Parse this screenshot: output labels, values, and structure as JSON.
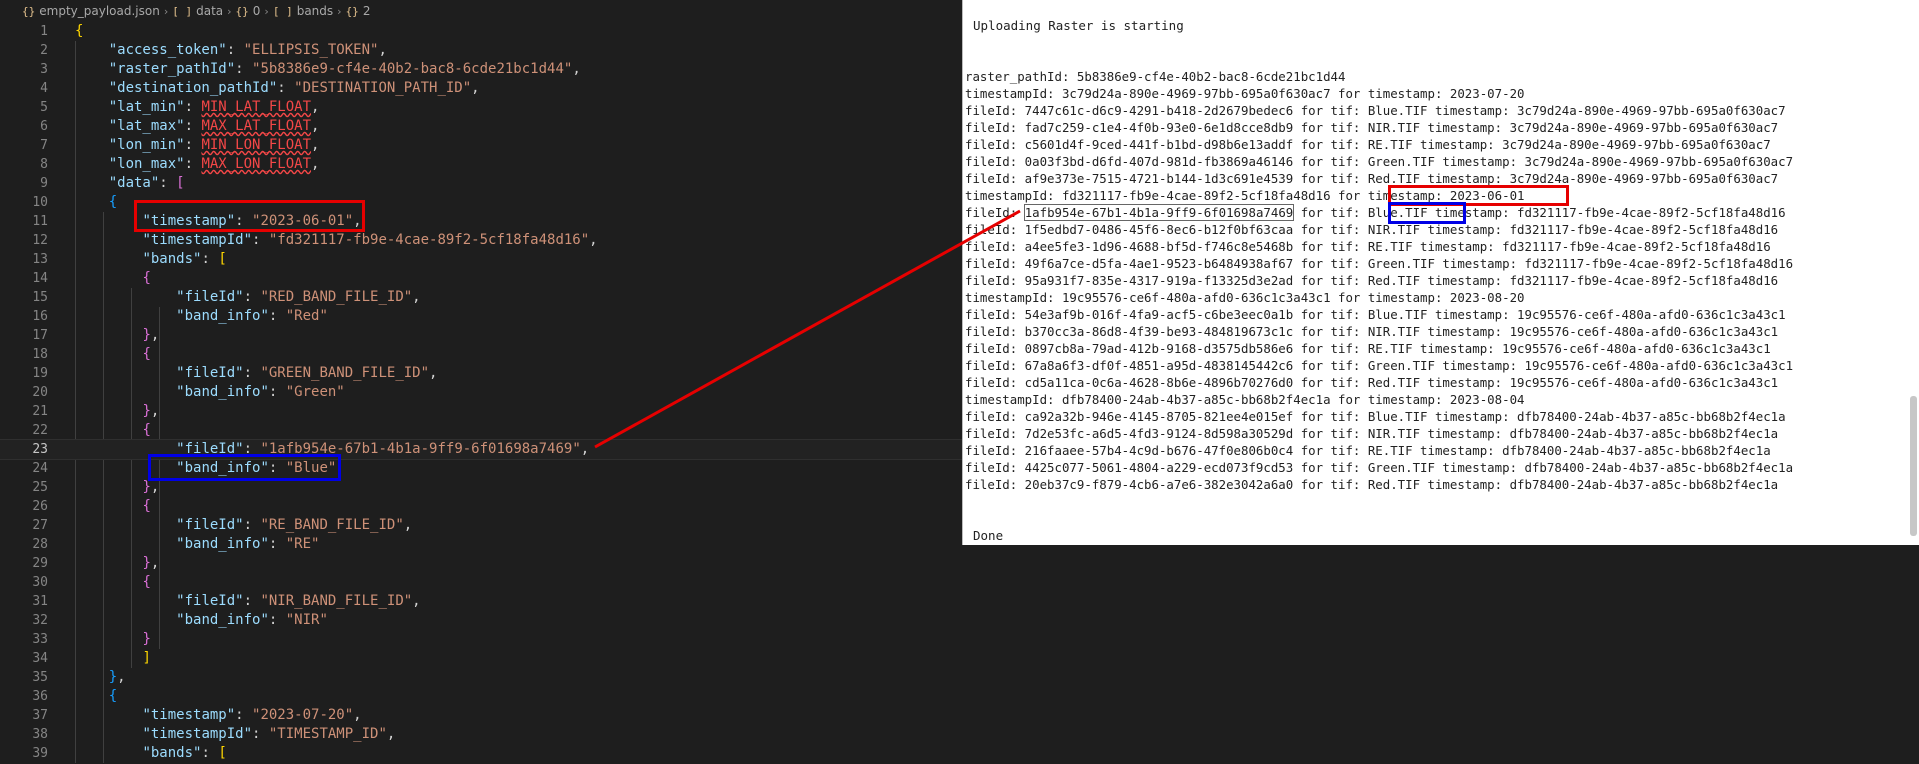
{
  "breadcrumb": {
    "file_icon": "{}",
    "file": "empty_payload.json",
    "items": [
      {
        "icon": "[ ]",
        "label": "data"
      },
      {
        "icon": "{}",
        "label": "0"
      },
      {
        "icon": "[ ]",
        "label": "bands"
      },
      {
        "icon": "{}",
        "label": "2"
      }
    ]
  },
  "editor": {
    "current_line": 23,
    "lines": [
      {
        "n": "1",
        "tokens": [
          {
            "t": "{",
            "c": "b1"
          }
        ]
      },
      {
        "n": "2",
        "tokens": [
          {
            "t": "    "
          },
          {
            "t": "\"access_token\"",
            "c": "k"
          },
          {
            "t": ": "
          },
          {
            "t": "\"ELLIPSIS_TOKEN\"",
            "c": "s"
          },
          {
            "t": ","
          }
        ]
      },
      {
        "n": "3",
        "tokens": [
          {
            "t": "    "
          },
          {
            "t": "\"raster_pathId\"",
            "c": "k"
          },
          {
            "t": ": "
          },
          {
            "t": "\"5b8386e9-cf4e-40b2-bac8-6cde21bc1d44\"",
            "c": "s"
          },
          {
            "t": ","
          }
        ]
      },
      {
        "n": "4",
        "tokens": [
          {
            "t": "    "
          },
          {
            "t": "\"destination_pathId\"",
            "c": "k"
          },
          {
            "t": ": "
          },
          {
            "t": "\"DESTINATION_PATH_ID\"",
            "c": "s"
          },
          {
            "t": ","
          }
        ]
      },
      {
        "n": "5",
        "tokens": [
          {
            "t": "    "
          },
          {
            "t": "\"lat_min\"",
            "c": "k"
          },
          {
            "t": ": "
          },
          {
            "t": "MIN_LAT_FLOAT",
            "c": "err"
          },
          {
            "t": ","
          }
        ]
      },
      {
        "n": "6",
        "tokens": [
          {
            "t": "    "
          },
          {
            "t": "\"lat_max\"",
            "c": "k"
          },
          {
            "t": ": "
          },
          {
            "t": "MAX_LAT_FLOAT",
            "c": "err"
          },
          {
            "t": ","
          }
        ]
      },
      {
        "n": "7",
        "tokens": [
          {
            "t": "    "
          },
          {
            "t": "\"lon_min\"",
            "c": "k"
          },
          {
            "t": ": "
          },
          {
            "t": "MIN_LON_FLOAT",
            "c": "err"
          },
          {
            "t": ","
          }
        ]
      },
      {
        "n": "8",
        "tokens": [
          {
            "t": "    "
          },
          {
            "t": "\"lon_max\"",
            "c": "k"
          },
          {
            "t": ": "
          },
          {
            "t": "MAX_LON_FLOAT",
            "c": "err"
          },
          {
            "t": ","
          }
        ]
      },
      {
        "n": "9",
        "tokens": [
          {
            "t": "    "
          },
          {
            "t": "\"data\"",
            "c": "k"
          },
          {
            "t": ": "
          },
          {
            "t": "[",
            "c": "b2"
          }
        ]
      },
      {
        "n": "10",
        "tokens": [
          {
            "t": "    "
          },
          {
            "t": "{",
            "c": "b3"
          }
        ]
      },
      {
        "n": "11",
        "tokens": [
          {
            "t": "        "
          },
          {
            "t": "\"timestamp\"",
            "c": "k"
          },
          {
            "t": ": "
          },
          {
            "t": "\"2023-06-01\"",
            "c": "s"
          },
          {
            "t": ","
          }
        ]
      },
      {
        "n": "12",
        "tokens": [
          {
            "t": "        "
          },
          {
            "t": "\"timestampId\"",
            "c": "k"
          },
          {
            "t": ": "
          },
          {
            "t": "\"fd321117-fb9e-4cae-89f2-5cf18fa48d16\"",
            "c": "s"
          },
          {
            "t": ","
          }
        ]
      },
      {
        "n": "13",
        "tokens": [
          {
            "t": "        "
          },
          {
            "t": "\"bands\"",
            "c": "k"
          },
          {
            "t": ": "
          },
          {
            "t": "[",
            "c": "b1"
          }
        ]
      },
      {
        "n": "14",
        "tokens": [
          {
            "t": "        "
          },
          {
            "t": "{",
            "c": "b2"
          }
        ]
      },
      {
        "n": "15",
        "tokens": [
          {
            "t": "            "
          },
          {
            "t": "\"fileId\"",
            "c": "k"
          },
          {
            "t": ": "
          },
          {
            "t": "\"RED_BAND_FILE_ID\"",
            "c": "s"
          },
          {
            "t": ","
          }
        ]
      },
      {
        "n": "16",
        "tokens": [
          {
            "t": "            "
          },
          {
            "t": "\"band_info\"",
            "c": "k"
          },
          {
            "t": ": "
          },
          {
            "t": "\"Red\"",
            "c": "s"
          }
        ]
      },
      {
        "n": "17",
        "tokens": [
          {
            "t": "        "
          },
          {
            "t": "}",
            "c": "b2"
          },
          {
            "t": ","
          }
        ]
      },
      {
        "n": "18",
        "tokens": [
          {
            "t": "        "
          },
          {
            "t": "{",
            "c": "b2"
          }
        ]
      },
      {
        "n": "19",
        "tokens": [
          {
            "t": "            "
          },
          {
            "t": "\"fileId\"",
            "c": "k"
          },
          {
            "t": ": "
          },
          {
            "t": "\"GREEN_BAND_FILE_ID\"",
            "c": "s"
          },
          {
            "t": ","
          }
        ]
      },
      {
        "n": "20",
        "tokens": [
          {
            "t": "            "
          },
          {
            "t": "\"band_info\"",
            "c": "k"
          },
          {
            "t": ": "
          },
          {
            "t": "\"Green\"",
            "c": "s"
          }
        ]
      },
      {
        "n": "21",
        "tokens": [
          {
            "t": "        "
          },
          {
            "t": "}",
            "c": "b2"
          },
          {
            "t": ","
          }
        ]
      },
      {
        "n": "22",
        "tokens": [
          {
            "t": "        "
          },
          {
            "t": "{",
            "c": "b2"
          }
        ]
      },
      {
        "n": "23",
        "tokens": [
          {
            "t": "            "
          },
          {
            "t": "\"fileId\"",
            "c": "k"
          },
          {
            "t": ": "
          },
          {
            "t": "\"1afb954e-67b1-4b1a-9ff9-6f01698a7469\"",
            "c": "s"
          },
          {
            "t": ","
          }
        ]
      },
      {
        "n": "24",
        "tokens": [
          {
            "t": "            "
          },
          {
            "t": "\"band_info\"",
            "c": "k"
          },
          {
            "t": ": "
          },
          {
            "t": "\"Blue\"",
            "c": "s"
          }
        ]
      },
      {
        "n": "25",
        "tokens": [
          {
            "t": "        "
          },
          {
            "t": "}",
            "c": "b2"
          },
          {
            "t": ","
          }
        ]
      },
      {
        "n": "26",
        "tokens": [
          {
            "t": "        "
          },
          {
            "t": "{",
            "c": "b2"
          }
        ]
      },
      {
        "n": "27",
        "tokens": [
          {
            "t": "            "
          },
          {
            "t": "\"fileId\"",
            "c": "k"
          },
          {
            "t": ": "
          },
          {
            "t": "\"RE_BAND_FILE_ID\"",
            "c": "s"
          },
          {
            "t": ","
          }
        ]
      },
      {
        "n": "28",
        "tokens": [
          {
            "t": "            "
          },
          {
            "t": "\"band_info\"",
            "c": "k"
          },
          {
            "t": ": "
          },
          {
            "t": "\"RE\"",
            "c": "s"
          }
        ]
      },
      {
        "n": "29",
        "tokens": [
          {
            "t": "        "
          },
          {
            "t": "}",
            "c": "b2"
          },
          {
            "t": ","
          }
        ]
      },
      {
        "n": "30",
        "tokens": [
          {
            "t": "        "
          },
          {
            "t": "{",
            "c": "b2"
          }
        ]
      },
      {
        "n": "31",
        "tokens": [
          {
            "t": "            "
          },
          {
            "t": "\"fileId\"",
            "c": "k"
          },
          {
            "t": ": "
          },
          {
            "t": "\"NIR_BAND_FILE_ID\"",
            "c": "s"
          },
          {
            "t": ","
          }
        ]
      },
      {
        "n": "32",
        "tokens": [
          {
            "t": "            "
          },
          {
            "t": "\"band_info\"",
            "c": "k"
          },
          {
            "t": ": "
          },
          {
            "t": "\"NIR\"",
            "c": "s"
          }
        ]
      },
      {
        "n": "33",
        "tokens": [
          {
            "t": "        "
          },
          {
            "t": "}",
            "c": "b2"
          }
        ]
      },
      {
        "n": "34",
        "tokens": [
          {
            "t": "        "
          },
          {
            "t": "]",
            "c": "b1"
          }
        ]
      },
      {
        "n": "35",
        "tokens": [
          {
            "t": "    "
          },
          {
            "t": "}",
            "c": "b3"
          },
          {
            "t": ","
          }
        ]
      },
      {
        "n": "36",
        "tokens": [
          {
            "t": "    "
          },
          {
            "t": "{",
            "c": "b3"
          }
        ]
      },
      {
        "n": "37",
        "tokens": [
          {
            "t": "        "
          },
          {
            "t": "\"timestamp\"",
            "c": "k"
          },
          {
            "t": ": "
          },
          {
            "t": "\"2023-07-20\"",
            "c": "s"
          },
          {
            "t": ","
          }
        ]
      },
      {
        "n": "38",
        "tokens": [
          {
            "t": "        "
          },
          {
            "t": "\"timestampId\"",
            "c": "k"
          },
          {
            "t": ": "
          },
          {
            "t": "\"TIMESTAMP_ID\"",
            "c": "s"
          },
          {
            "t": ","
          }
        ]
      },
      {
        "n": "39",
        "tokens": [
          {
            "t": "        "
          },
          {
            "t": "\"bands\"",
            "c": "k"
          },
          {
            "t": ": "
          },
          {
            "t": "[",
            "c": "b1"
          }
        ]
      }
    ]
  },
  "terminal": {
    "header": "Uploading Raster is starting",
    "footer": "Done",
    "log": [
      "raster_pathId: 5b8386e9-cf4e-40b2-bac8-6cde21bc1d44",
      "timestampId: 3c79d24a-890e-4969-97bb-695a0f630ac7 for timestamp: 2023-07-20",
      "fileId: 7447c61c-d6c9-4291-b418-2d2679bedec6 for tif: Blue.TIF timestamp: 3c79d24a-890e-4969-97bb-695a0f630ac7",
      "fileId: fad7c259-c1e4-4f0b-93e0-6e1d8cce8db9 for tif: NIR.TIF timestamp: 3c79d24a-890e-4969-97bb-695a0f630ac7",
      "fileId: c5601d4f-9ced-441f-b1bd-d98b6e13addf for tif: RE.TIF timestamp: 3c79d24a-890e-4969-97bb-695a0f630ac7",
      "fileId: 0a03f3bd-d6fd-407d-981d-fb3869a46146 for tif: Green.TIF timestamp: 3c79d24a-890e-4969-97bb-695a0f630ac7",
      "fileId: af9e373e-7515-4721-b144-1d3c691e4539 for tif: Red.TIF timestamp: 3c79d24a-890e-4969-97bb-695a0f630ac7",
      "timestampId: fd321117-fb9e-4cae-89f2-5cf18fa48d16 for timestamp: 2023-06-01",
      "fileId: 1afb954e-67b1-4b1a-9ff9-6f01698a7469 for tif: Blue.TIF timestamp: fd321117-fb9e-4cae-89f2-5cf18fa48d16",
      "fileId: 1f5edbd7-0486-45f6-8ec6-b12f0bf63caa for tif: NIR.TIF timestamp: fd321117-fb9e-4cae-89f2-5cf18fa48d16",
      "fileId: a4ee5fe3-1d96-4688-bf5d-f746c8e5468b for tif: RE.TIF timestamp: fd321117-fb9e-4cae-89f2-5cf18fa48d16",
      "fileId: 49f6a7ce-d5fa-4ae1-9523-b6484938af67 for tif: Green.TIF timestamp: fd321117-fb9e-4cae-89f2-5cf18fa48d16",
      "fileId: 95a931f7-835e-4317-919a-f13325d3e2ad for tif: Red.TIF timestamp: fd321117-fb9e-4cae-89f2-5cf18fa48d16",
      "timestampId: 19c95576-ce6f-480a-afd0-636c1c3a43c1 for timestamp: 2023-08-20",
      "fileId: 54e3af9b-016f-4fa9-acf5-c6be3eec0a1b for tif: Blue.TIF timestamp: 19c95576-ce6f-480a-afd0-636c1c3a43c1",
      "fileId: b370cc3a-86d8-4f39-be93-484819673c1c for tif: NIR.TIF timestamp: 19c95576-ce6f-480a-afd0-636c1c3a43c1",
      "fileId: 0897cb8a-79ad-412b-9168-d3575db586e6 for tif: RE.TIF timestamp: 19c95576-ce6f-480a-afd0-636c1c3a43c1",
      "fileId: 67a8a6f3-df0f-4851-a95d-4838145442c6 for tif: Green.TIF timestamp: 19c95576-ce6f-480a-afd0-636c1c3a43c1",
      "fileId: cd5a11ca-0c6a-4628-8b6e-4896b70276d0 for tif: Red.TIF timestamp: 19c95576-ce6f-480a-afd0-636c1c3a43c1",
      "timestampId: dfb78400-24ab-4b37-a85c-bb68b2f4ec1a for timestamp: 2023-08-04",
      "fileId: ca92a32b-946e-4145-8705-821ee4e015ef for tif: Blue.TIF timestamp: dfb78400-24ab-4b37-a85c-bb68b2f4ec1a",
      "fileId: 7d2e53fc-a6d5-4fd3-9124-8d598a30529d for tif: NIR.TIF timestamp: dfb78400-24ab-4b37-a85c-bb68b2f4ec1a",
      "fileId: 216faaee-57b4-4c9d-b676-47f0e806b0c4 for tif: RE.TIF timestamp: dfb78400-24ab-4b37-a85c-bb68b2f4ec1a",
      "fileId: 4425c077-5061-4804-a229-ecd073f9cd53 for tif: Green.TIF timestamp: dfb78400-24ab-4b37-a85c-bb68b2f4ec1a",
      "fileId: 20eb37c9-f879-4cb6-a7e6-382e3042a6a0 for tif: Red.TIF timestamp: dfb78400-24ab-4b37-a85c-bb68b2f4ec1a"
    ],
    "selected_text": "1afb954e-67b1-4b1a-9ff9-6f01698a7469"
  },
  "colors": {
    "annotation_red": "#e60000",
    "annotation_blue": "#0000e6",
    "editor_bg": "#1e1e1e",
    "terminal_bg": "#ffffff"
  }
}
